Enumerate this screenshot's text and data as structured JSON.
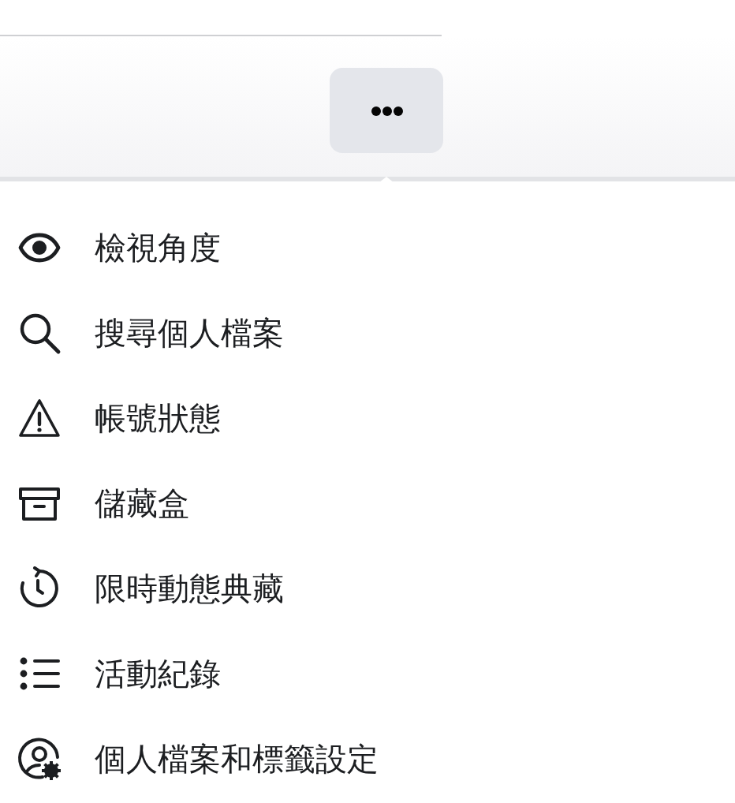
{
  "menu": {
    "items": [
      {
        "label": "檢視角度"
      },
      {
        "label": "搜尋個人檔案"
      },
      {
        "label": "帳號狀態"
      },
      {
        "label": "儲藏盒"
      },
      {
        "label": "限時動態典藏"
      },
      {
        "label": "活動紀錄"
      },
      {
        "label": "個人檔案和標籤設定"
      }
    ]
  }
}
